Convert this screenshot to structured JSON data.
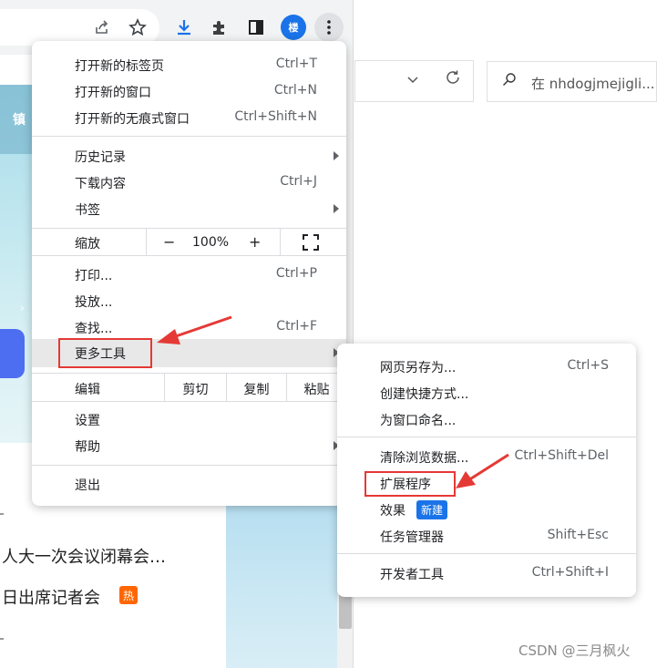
{
  "left_window": {
    "toolbar": {
      "icons": [
        "share-icon",
        "star-icon",
        "download-icon",
        "extensions-icon",
        "side-panel-icon"
      ],
      "avatar_text": "楼",
      "menu_icon": "kebab-menu-icon"
    },
    "page": {
      "banner_nav_text": "镇",
      "news": [
        "人大一次会议闭幕会…",
        "日出席记者会"
      ],
      "hot_badge": "热"
    }
  },
  "right_window": {
    "search_placeholder": "在 nhdogjmejigli...",
    "watermark": "CSDN @三月枫火"
  },
  "main_menu": {
    "items": [
      {
        "label": "打开新的标签页",
        "shortcut": "Ctrl+T"
      },
      {
        "label": "打开新的窗口",
        "shortcut": "Ctrl+N"
      },
      {
        "label": "打开新的无痕式窗口",
        "shortcut": "Ctrl+Shift+N"
      },
      {
        "label": "历史记录",
        "shortcut": ""
      },
      {
        "label": "下载内容",
        "shortcut": "Ctrl+J"
      },
      {
        "label": "书签",
        "shortcut": ""
      },
      {
        "label": "打印...",
        "shortcut": "Ctrl+P"
      },
      {
        "label": "投放...",
        "shortcut": ""
      },
      {
        "label": "查找...",
        "shortcut": "Ctrl+F"
      },
      {
        "label": "更多工具",
        "shortcut": ""
      },
      {
        "label": "设置",
        "shortcut": ""
      },
      {
        "label": "帮助",
        "shortcut": ""
      },
      {
        "label": "退出",
        "shortcut": ""
      }
    ],
    "zoom": {
      "label": "缩放",
      "minus": "−",
      "value": "100%",
      "plus": "+"
    },
    "edit": {
      "label": "编辑",
      "cut": "剪切",
      "copy": "复制",
      "paste": "粘贴"
    }
  },
  "sub_menu": {
    "items": [
      {
        "label": "网页另存为...",
        "shortcut": "Ctrl+S"
      },
      {
        "label": "创建快捷方式...",
        "shortcut": ""
      },
      {
        "label": "为窗口命名...",
        "shortcut": ""
      },
      {
        "label": "清除浏览数据...",
        "shortcut": "Ctrl+Shift+Del"
      },
      {
        "label": "扩展程序",
        "shortcut": ""
      },
      {
        "label": "效果",
        "shortcut": "",
        "badge": "新建"
      },
      {
        "label": "任务管理器",
        "shortcut": "Shift+Esc"
      },
      {
        "label": "开发者工具",
        "shortcut": "Ctrl+Shift+I"
      }
    ]
  },
  "colors": {
    "accent": "#1a73e8",
    "annotation_red": "#e53935",
    "menu_hover": "#e8e8e8"
  }
}
